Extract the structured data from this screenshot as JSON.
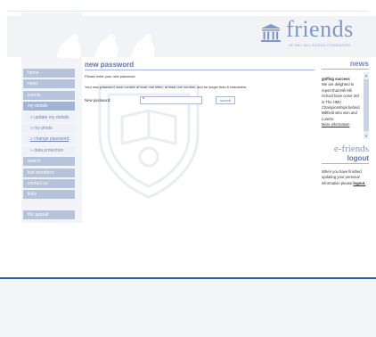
{
  "brand": {
    "word": "friends",
    "subtitle": "OF MILL HILL SCHOOL FOUNDATION",
    "accent_color": "#7f98c8",
    "footer_color": "#2f5fa8"
  },
  "nav": {
    "items": [
      {
        "label": "home"
      },
      {
        "label": "news"
      },
      {
        "label": "events"
      },
      {
        "label": "my details"
      }
    ],
    "subitems": [
      {
        "label": "update my details"
      },
      {
        "label": "my photo"
      },
      {
        "label": "change password"
      },
      {
        "label": "data protection"
      }
    ],
    "lower": [
      {
        "label": "search"
      },
      {
        "label": "lost members"
      },
      {
        "label": "contact us"
      },
      {
        "label": "links"
      }
    ],
    "appeal": "the appeal"
  },
  "main": {
    "title": "new password",
    "intro": "Please enter your new password.",
    "rule_text": "Your new password must contain at least one letter, at least one number, and be longer than 6 characters.",
    "field_label": "New password:",
    "field_value": "*",
    "submit_label": "submit"
  },
  "news": {
    "title": "news",
    "headline": "golfing success",
    "body": "We are delighted to report that Mill Hill School have come 3rd in The HMC Championships behind Millfield who won and Loretto.",
    "more": "More information"
  },
  "efriends": {
    "title": "e-friends",
    "logout_title": "logout",
    "text": "When you have finished updating your personal information please",
    "link": "logout."
  }
}
